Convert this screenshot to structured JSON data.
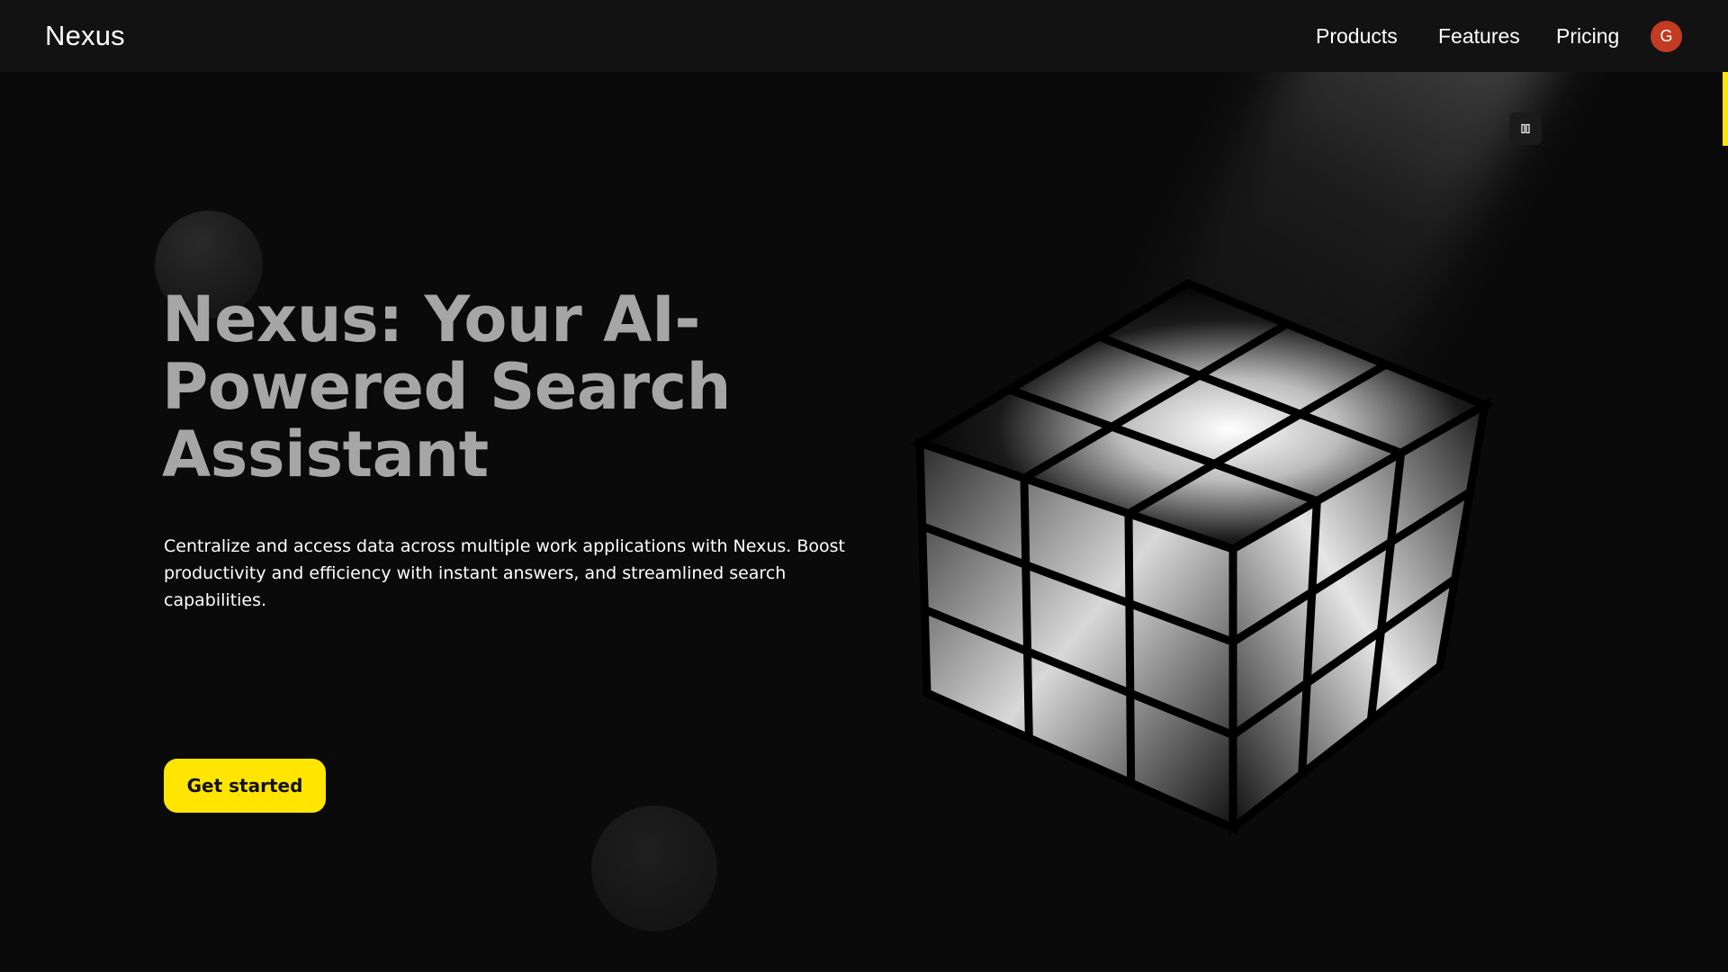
{
  "header": {
    "brand": "Nexus",
    "nav": {
      "products": "Products",
      "features": "Features",
      "pricing": "Pricing"
    },
    "avatar_initial": "G"
  },
  "hero": {
    "title": "Nexus: Your AI-Powered Search Assistant",
    "description": "Centralize and access data across multiple work applications with Nexus. Boost productivity and efficiency with instant answers, and streamlined search capabilities.",
    "cta_label": "Get started"
  },
  "controls": {
    "pause_icon": "pause-icon"
  },
  "colors": {
    "accent": "#ffe500",
    "background": "#0a0a0a",
    "navbar": "#121212",
    "avatar": "#c23b22",
    "title": "#a6a6a6"
  }
}
